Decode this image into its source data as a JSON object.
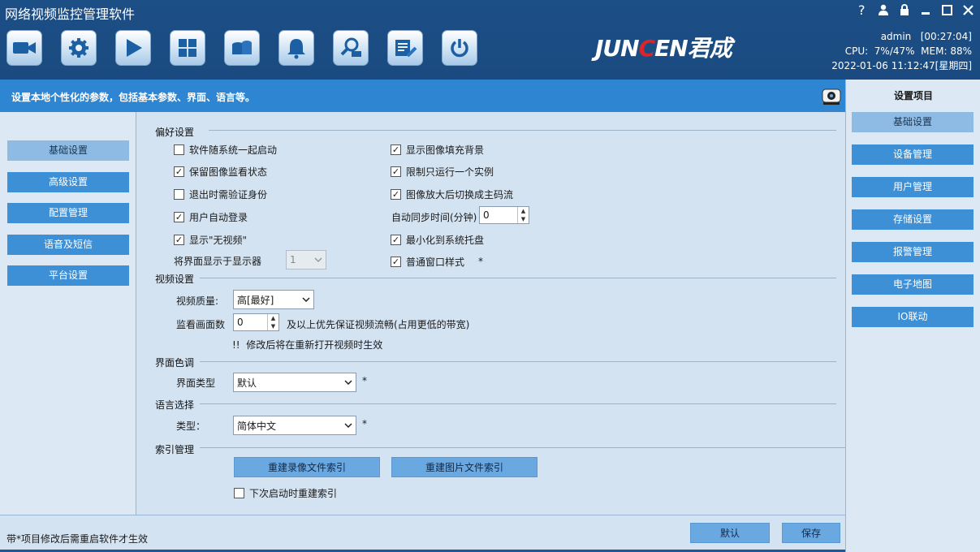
{
  "app": {
    "title": "网络视频监控管理软件"
  },
  "window_controls": [
    {
      "icon": "help-icon"
    },
    {
      "icon": "user-icon"
    },
    {
      "icon": "lock-icon"
    },
    {
      "icon": "minimize-icon"
    },
    {
      "icon": "maximize-icon"
    },
    {
      "icon": "close-icon"
    }
  ],
  "toolbar": [
    {
      "icon": "camera-icon"
    },
    {
      "icon": "settings-gear-icon"
    },
    {
      "icon": "play-icon"
    },
    {
      "icon": "grid-layout-icon"
    },
    {
      "icon": "storage-icon"
    },
    {
      "icon": "alarm-bell-icon"
    },
    {
      "icon": "search-device-icon"
    },
    {
      "icon": "config-tools-icon"
    },
    {
      "icon": "power-icon"
    }
  ],
  "logo": {
    "part1": "JUN",
    "part2": "C",
    "part3": "EN",
    "part4": "君成"
  },
  "sysinfo": {
    "user_line": "admin   [00:27:04]",
    "usage_line": "CPU:  7%/47%  MEM: 88%",
    "datetime": "2022-01-06 11:12:47[星期四]"
  },
  "infobar": {
    "text": "设置本地个性化的参数，包括基本参数、界面、语言等。"
  },
  "left_nav": [
    "基础设置",
    "高级设置",
    "配置管理",
    "语音及短信",
    "平台设置"
  ],
  "sections": {
    "prefs": "偏好设置",
    "video": "视频设置",
    "theme": "界面色调",
    "lang": "语言选择",
    "index": "索引管理"
  },
  "prefs_left": [
    {
      "label": "软件随系统一起启动",
      "checked": false
    },
    {
      "label": "保留图像监看状态",
      "checked": true
    },
    {
      "label": "退出时需验证身份",
      "checked": false
    },
    {
      "label": "用户自动登录",
      "checked": true
    },
    {
      "label": "显示\"无视频\"",
      "checked": true
    }
  ],
  "prefs_right": [
    {
      "label": "显示图像填充背景",
      "checked": true
    },
    {
      "label": "限制只运行一个实例",
      "checked": true
    },
    {
      "label": "图像放大后切换成主码流",
      "checked": true
    }
  ],
  "prefs_right_lower": [
    {
      "label": "最小化到系统托盘",
      "checked": true
    },
    {
      "label": "普通窗口样式",
      "checked": true,
      "note": "*"
    }
  ],
  "auto_sync": {
    "label": "自动同步时间(分钟)",
    "value": "0"
  },
  "monitor_display": {
    "label": "将界面显示于显示器",
    "value": "1"
  },
  "video": {
    "quality_label": "视频质量:",
    "quality_value": "高[最好]",
    "count_label": "监看画面数",
    "count_value": "0",
    "count_hint": "及以上优先保证视频流畅(占用更低的带宽)",
    "notice": "!!  修改后将在重新打开视频时生效"
  },
  "theme": {
    "label": "界面类型",
    "value": "默认",
    "note": "*"
  },
  "lang": {
    "label": "类型：",
    "value": "简体中文",
    "note": "*"
  },
  "index": {
    "rebuild_video": "重建录像文件索引",
    "rebuild_image": "重建图片文件索引",
    "next_start": {
      "label": "下次启动时重建索引",
      "checked": false
    }
  },
  "footer": {
    "note": "带*项目修改后需重启软件才生效",
    "default": "默认",
    "save": "保存"
  },
  "right_panel": {
    "title": "设置项目",
    "items": [
      "基础设置",
      "设备管理",
      "用户管理",
      "存储设置",
      "报警管理",
      "电子地图",
      "IO联动"
    ]
  }
}
